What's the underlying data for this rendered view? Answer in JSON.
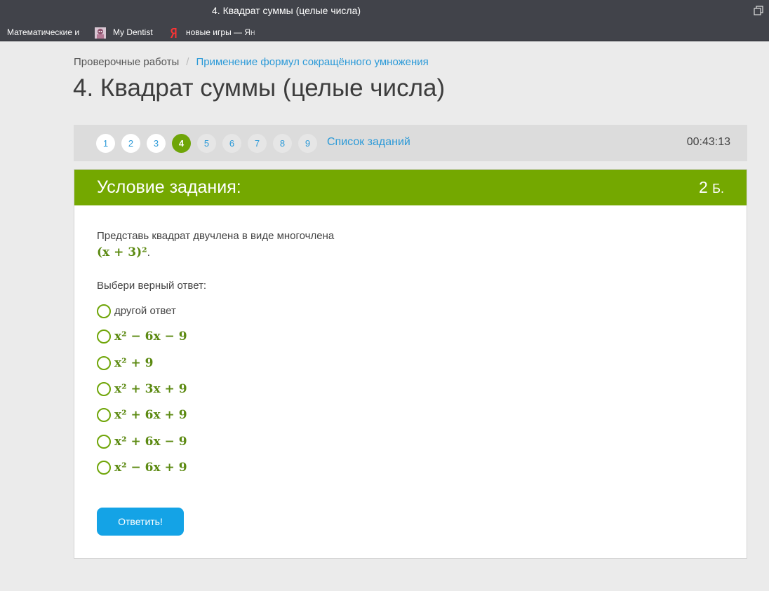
{
  "window": {
    "title": "4. Квадрат суммы (целые числа)"
  },
  "bookmarks": [
    {
      "label": "Математические и",
      "icon": ""
    },
    {
      "label": "My Dentist",
      "icon": "avatar-icon"
    },
    {
      "label": "новые игры — Ян",
      "icon": "yandex-icon"
    }
  ],
  "breadcrumb": {
    "parent": "Проверочные работы",
    "separator": "/",
    "current": "Применение формул сокращённого умножения"
  },
  "page_title": "4. Квадрат суммы (целые числа)",
  "task_nav": {
    "tasks": [
      "1",
      "2",
      "3",
      "4",
      "5",
      "6",
      "7",
      "8",
      "9"
    ],
    "active_task": "4",
    "list_label": "Список заданий",
    "timer": "00:43:13"
  },
  "task": {
    "header": "Условие задания:",
    "points": "2",
    "points_unit": "Б.",
    "question": "Представь квадрат двучлена в виде многочлена",
    "formula": "(x + 3)²",
    "prompt": "Выбери верный ответ:",
    "options": [
      "другой ответ",
      "x² − 6x − 9",
      "x² + 9",
      "x² + 3x + 9",
      "x² + 6x + 9",
      "x² + 6x − 9",
      "x² − 6x + 9"
    ],
    "submit_label": "Ответить!"
  },
  "colors": {
    "accent_green": "#74a800",
    "link_blue": "#2c9ad8",
    "button_blue": "#14a3e6",
    "titlebar": "#41434a"
  }
}
